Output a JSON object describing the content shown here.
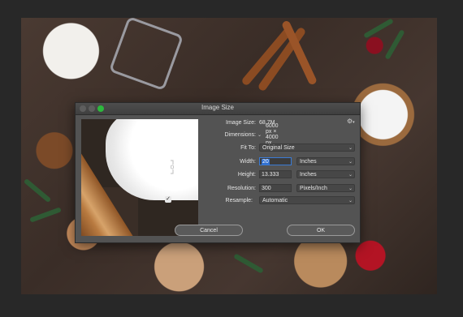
{
  "dialog": {
    "title": "Image Size",
    "image_size_label": "Image Size:",
    "image_size_value": "68.7M",
    "dimensions_label": "Dimensions:",
    "dimensions_value": "6000 px  ×  4000 px",
    "fit_to_label": "Fit To:",
    "fit_to_value": "Original Size",
    "width_label": "Width:",
    "width_value": "20",
    "width_unit": "Inches",
    "height_label": "Height:",
    "height_value": "13.333",
    "height_unit": "Inches",
    "resolution_label": "Resolution:",
    "resolution_value": "300",
    "resolution_unit": "Pixels/Inch",
    "resample_label": "Resample:",
    "resample_checked": "✓",
    "resample_value": "Automatic",
    "cancel_label": "Cancel",
    "ok_label": "OK"
  },
  "icons": {
    "settings": "gear-icon",
    "chevron": "chevron-down-icon",
    "dims_chevron": "chevron-down-icon",
    "link": "link-icon"
  },
  "colors": {
    "dialog_bg": "#535353",
    "focus": "#3a7bd5",
    "close_button_green": "#2db83d"
  }
}
